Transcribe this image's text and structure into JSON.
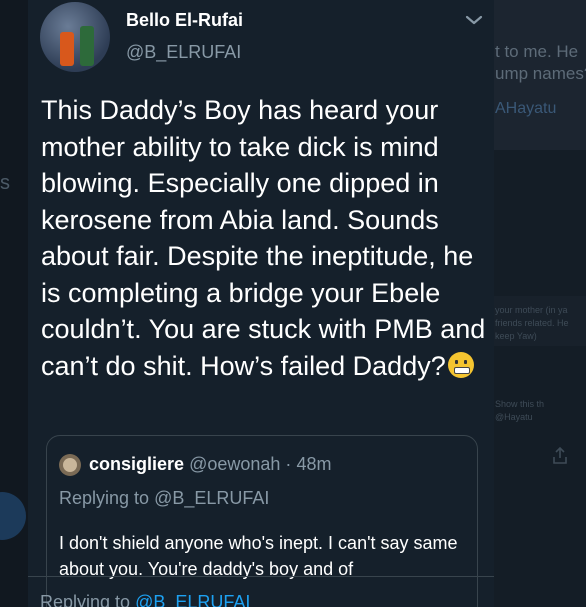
{
  "background": {
    "side_letter": "s",
    "card_line1": "t to me. He",
    "card_line2": "ump names?",
    "card_handle": "AHayatu",
    "small_line1": "your mother (in ya",
    "small_line2": "friends related. He",
    "small_line3": "keep Yaw)",
    "small_line4": "Show this th",
    "small_line5": "@Hayatu"
  },
  "tweet": {
    "author_name": "Bello El-Rufai",
    "author_handle": "@B_ELRUFAI",
    "text": "This Daddy’s Boy has heard your mother ability to take dick is mind blowing. Especially one dipped in kerosene from Abia land. Sounds about fair. Despite the ineptitude, he is completing a bridge your Ebele couldn’t. You are stuck with PMB and can’t do shit. How’s failed Daddy?",
    "emoji": "grimacing-face-emoji"
  },
  "quoted_tweet": {
    "author_name": "consigliere",
    "author_handle": "@oewonah",
    "separator": "·",
    "time": "48m",
    "replying_prefix": "Replying to",
    "replying_handle": "@B_ELRUFAI",
    "text": "I don't shield anyone who's inept. I can't say same about you. You're daddy's boy and of"
  },
  "bottom": {
    "replying_prefix": "Replying to",
    "replying_handle": "@B_ELRUFAI"
  },
  "icons": {
    "menu": "chevron-down-icon",
    "share": "share-icon"
  }
}
